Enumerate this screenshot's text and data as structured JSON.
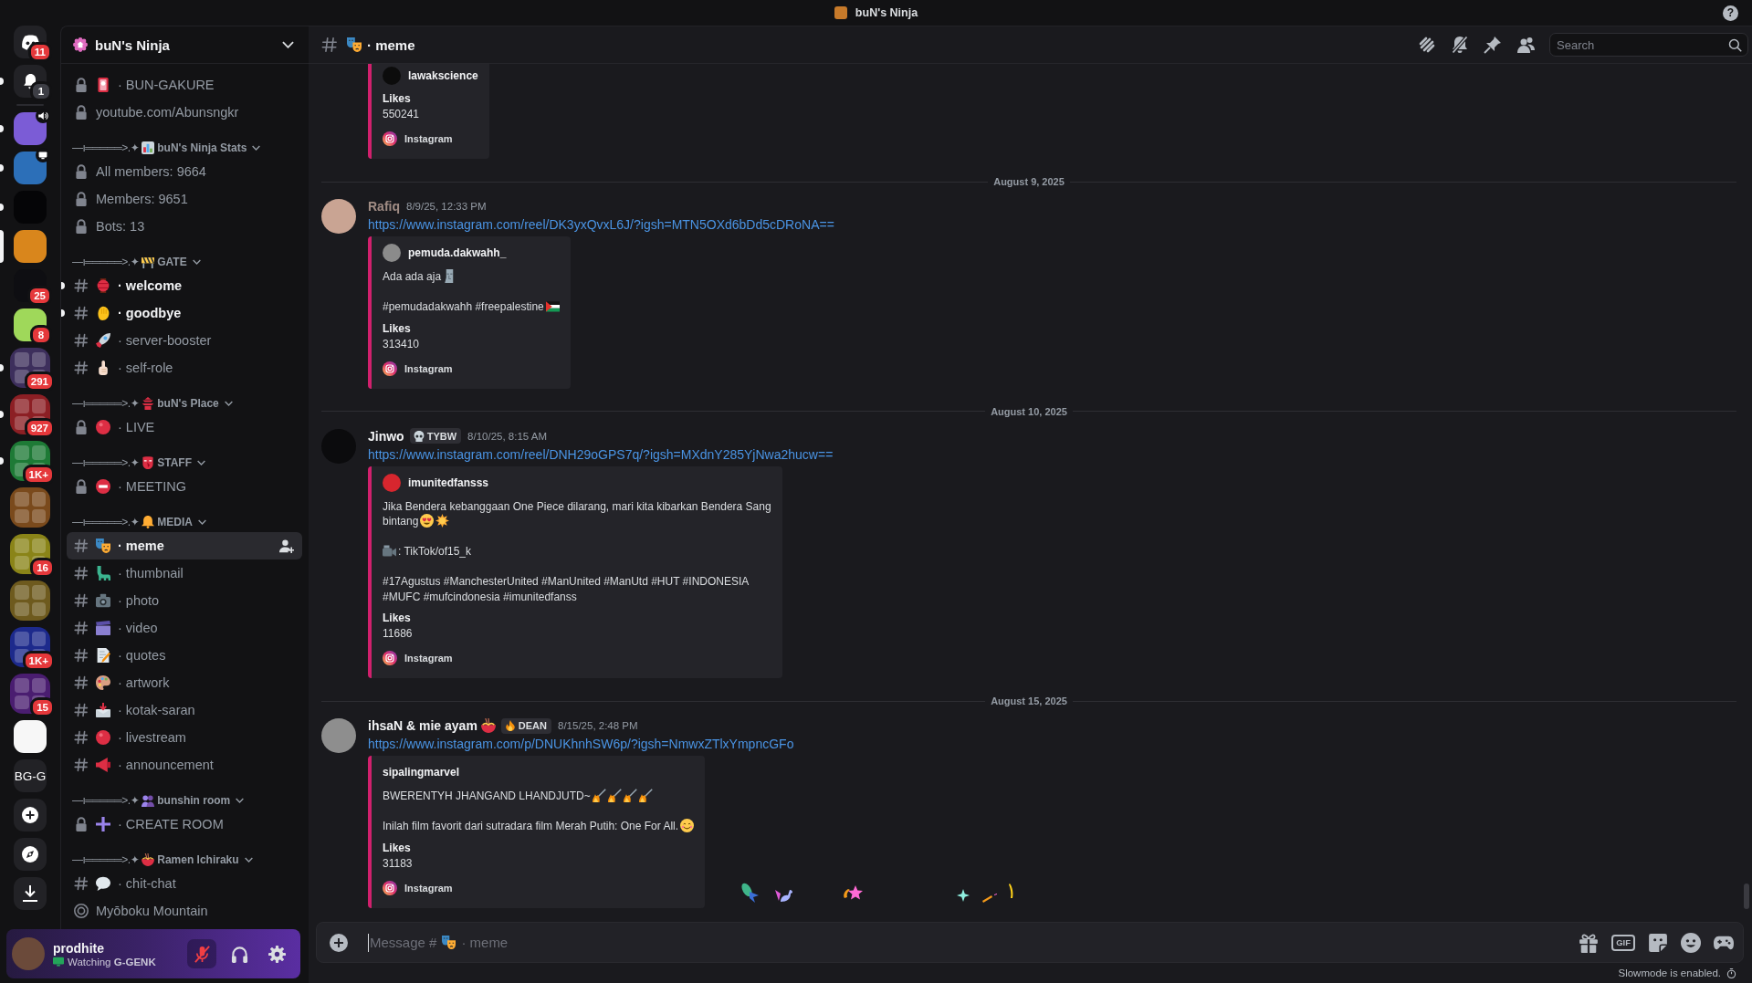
{
  "title_bar": {
    "title": "buN's Ninja",
    "help": "?"
  },
  "servers": [
    {
      "kind": "home",
      "badge": "11",
      "unread": false,
      "selected": false
    },
    {
      "kind": "inbox",
      "badge": "1",
      "unread": true,
      "selected": false
    },
    {
      "kind": "server",
      "color": "#7b5cd6",
      "voice": true,
      "unread": true,
      "selected": false
    },
    {
      "kind": "server",
      "color": "#2c6fb8",
      "streaming": true,
      "unread": true,
      "selected": false
    },
    {
      "kind": "server",
      "color": "#050507",
      "unread": true,
      "selected": false
    },
    {
      "kind": "server",
      "color": "#d9861c",
      "unread": false,
      "selected": true
    },
    {
      "kind": "server",
      "color": "#0e0e12",
      "badge": "25",
      "unread": false,
      "selected": false
    },
    {
      "kind": "server",
      "color": "#9fd85a",
      "badge": "8",
      "unread": false,
      "selected": false
    },
    {
      "kind": "folder",
      "color": "#3d2f5c",
      "badge": "291",
      "unread": true,
      "selected": false
    },
    {
      "kind": "folder",
      "color": "#8c1f24",
      "badge": "927",
      "unread": true,
      "selected": false
    },
    {
      "kind": "folder",
      "color": "#1e7a36",
      "badge": "1K+",
      "unread": true,
      "selected": false
    },
    {
      "kind": "folder",
      "color": "#7a4a1c",
      "unread": false,
      "selected": false
    },
    {
      "kind": "folder",
      "color": "#8a8418",
      "badge": "16",
      "unread": false,
      "selected": false
    },
    {
      "kind": "folder",
      "color": "#6e5a1e",
      "unread": false,
      "selected": false
    },
    {
      "kind": "folder",
      "color": "#1d2a8c",
      "badge": "1K+",
      "unread": false,
      "selected": false
    },
    {
      "kind": "folder",
      "color": "#4a1d70",
      "badge": "15",
      "unread": false,
      "selected": false
    },
    {
      "kind": "server",
      "color": "#f7f7f7",
      "unread": false,
      "selected": false
    },
    {
      "kind": "text",
      "label": "BG-G",
      "unread": false,
      "selected": false
    },
    {
      "kind": "add"
    },
    {
      "kind": "discover"
    },
    {
      "kind": "download"
    }
  ],
  "sidebar": {
    "server_name": "buN's Ninja",
    "groups": [
      {
        "channels": [
          {
            "kind": "locked",
            "name": "· BUN-GAKURE",
            "unread": false,
            "selected": false
          },
          {
            "kind": "locked",
            "name": "youtube.com/Abunsngkr",
            "unread": false,
            "selected": false
          }
        ]
      },
      {
        "category": {
          "prefix": "—ı═════>.✦",
          "name": "buN's Ninja Stats",
          "expanded": true
        },
        "channels": [
          {
            "kind": "locked",
            "name": "All members: 9664",
            "unread": false,
            "selected": false
          },
          {
            "kind": "locked",
            "name": "Members: 9651",
            "unread": false,
            "selected": false
          },
          {
            "kind": "locked",
            "name": "Bots: 13",
            "unread": false,
            "selected": false
          }
        ]
      },
      {
        "category": {
          "prefix": "—ı═════>.✦",
          "name": "GATE",
          "expanded": true
        },
        "channels": [
          {
            "kind": "text",
            "name": "· welcome",
            "unread": true,
            "selected": false
          },
          {
            "kind": "text",
            "name": "· goodbye",
            "unread": true,
            "selected": false
          },
          {
            "kind": "text",
            "name": "· server-booster",
            "unread": false,
            "selected": false
          },
          {
            "kind": "text",
            "name": "· self-role",
            "unread": false,
            "selected": false
          }
        ]
      },
      {
        "category": {
          "prefix": "—ı═════>.✦",
          "name": "buN's Place",
          "expanded": true
        },
        "channels": [
          {
            "kind": "locked",
            "name": "· LIVE",
            "unread": false,
            "selected": false
          }
        ]
      },
      {
        "category": {
          "prefix": "—ı═════>.✦",
          "name": "STAFF",
          "expanded": true
        },
        "channels": [
          {
            "kind": "locked",
            "name": "· MEETING",
            "unread": false,
            "selected": false
          }
        ]
      },
      {
        "category": {
          "prefix": "—ı═════>.✦",
          "name": "MEDIA",
          "expanded": true
        },
        "channels": [
          {
            "kind": "text",
            "name": "· meme",
            "unread": false,
            "selected": true
          },
          {
            "kind": "text",
            "name": "· thumbnail",
            "unread": false,
            "selected": false
          },
          {
            "kind": "text",
            "name": "· photo",
            "unread": false,
            "selected": false
          },
          {
            "kind": "text",
            "name": "· video",
            "unread": false,
            "selected": false
          },
          {
            "kind": "text",
            "name": "· quotes",
            "unread": false,
            "selected": false
          },
          {
            "kind": "text",
            "name": "· artwork",
            "unread": false,
            "selected": false
          },
          {
            "kind": "text",
            "name": "· kotak-saran",
            "unread": false,
            "selected": false
          },
          {
            "kind": "text",
            "name": "· livestream",
            "unread": false,
            "selected": false
          },
          {
            "kind": "text",
            "name": "· announcement",
            "unread": false,
            "selected": false
          }
        ]
      },
      {
        "category": {
          "prefix": "—ı═════>.✦",
          "name": "bunshin room",
          "expanded": true
        },
        "channels": [
          {
            "kind": "locked",
            "name": "· CREATE ROOM",
            "unread": false,
            "selected": false
          }
        ]
      },
      {
        "category": {
          "prefix": "—ı═════>.✦",
          "name": "Ramen Ichiraku",
          "expanded": true
        },
        "channels": [
          {
            "kind": "text",
            "name": "· chit-chat",
            "unread": false,
            "selected": false
          },
          {
            "kind": "stage",
            "name": "Myōboku Mountain",
            "unread": false,
            "selected": false
          }
        ]
      }
    ]
  },
  "user_panel": {
    "username": "prodhite",
    "status": "Watching **G-GENK**",
    "muted": true
  },
  "channel_header": {
    "name": "· meme",
    "search": {
      "placeholder": "Search"
    }
  },
  "messages": [
    {
      "kind": "continuation",
      "embed": {
        "author": "lawakscience",
        "fields": [
          {
            "name": "Likes",
            "value": "550241"
          }
        ],
        "footer": "Instagram"
      }
    },
    {
      "kind": "divider",
      "label": "August 9, 2025"
    },
    {
      "kind": "message",
      "author": "Rafiq",
      "color": "#a08c84",
      "time": "8/9/25, 12:33 PM",
      "link": "https://www.instagram.com/reel/DK3yxQvxL6J/?igsh=MTN5OXd6bDd5cDRoNA==",
      "embed": {
        "author": "pemuda.dakwahh_",
        "description": [
          [
            "Ada ada aja"
          ],
          [
            "#pemudadakwahh #freepalestine"
          ]
        ],
        "fields": [
          {
            "name": "Likes",
            "value": "313410"
          }
        ],
        "footer": "Instagram"
      }
    },
    {
      "kind": "divider",
      "label": "August 10, 2025"
    },
    {
      "kind": "message",
      "author": "Jinwo",
      "color": "#f2f3f5",
      "tag": "TYBW",
      "time": "8/10/25, 8:15 AM",
      "link": "https://www.instagram.com/reel/DNH29oGPS7q/?igsh=MXdnY285YjNwa2hucw==",
      "embed": {
        "author": "imunitedfansss",
        "description": [
          [
            "Jika Bendera kebanggaan One Piece dilarang, mari kita kibarkan Bendera Sang",
            "bintang"
          ],
          [
            ": TikTok/of15_k"
          ],
          [
            "#17Agustus #ManchesterUnited #ManUnited #ManUtd #HUT #INDONESIA",
            "#MUFC #mufcindonesia #imunitedfanss"
          ]
        ],
        "fields": [
          {
            "name": "Likes",
            "value": "11686"
          }
        ],
        "footer": "Instagram"
      }
    },
    {
      "kind": "divider",
      "label": "August 15, 2025"
    },
    {
      "kind": "message",
      "author": "ihsaN & mie ayam",
      "color": "#f2f3f5",
      "tag": "DEAN",
      "time": "8/15/25, 2:48 PM",
      "link": "https://www.instagram.com/p/DNUKhnhSW6p/?igsh=NmwxZTlxYmpncGFo",
      "embed": {
        "author": "sipalingmarvel",
        "description": [
          [
            "BWERENTYH JHANGAND LHANDJUTD~"
          ],
          [
            "Inilah film favorit dari sutradara film Merah Putih: One For All."
          ]
        ],
        "fields": [
          {
            "name": "Likes",
            "value": "31183"
          }
        ],
        "footer": "Instagram"
      }
    }
  ],
  "composer": {
    "placeholder": "Message #",
    "channel": "· meme",
    "gif": "GIF"
  },
  "slowmode": "Slowmode is enabled."
}
